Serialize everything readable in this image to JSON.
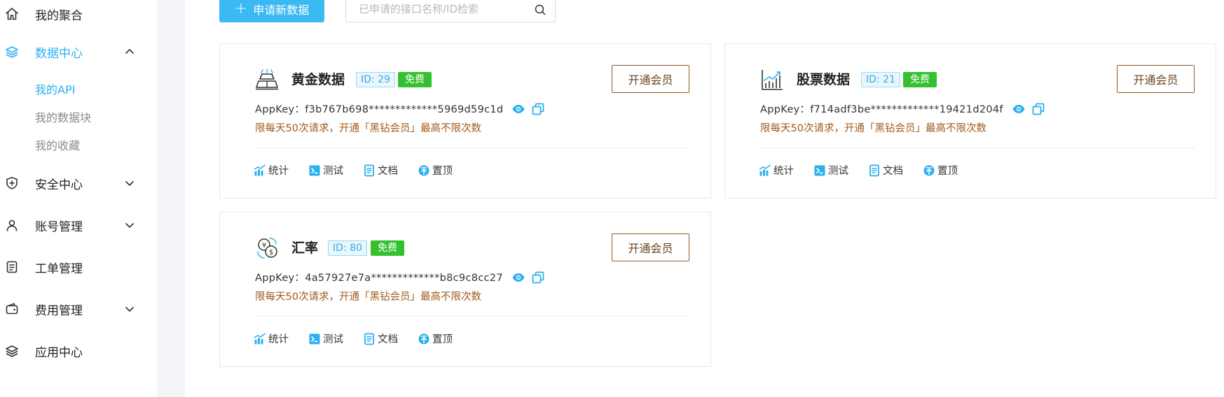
{
  "sidebar": {
    "items": [
      {
        "label": "我的聚合"
      },
      {
        "label": "数据中心"
      },
      {
        "label": "安全中心"
      },
      {
        "label": "账号管理"
      },
      {
        "label": "工单管理"
      },
      {
        "label": "费用管理"
      },
      {
        "label": "应用中心"
      }
    ],
    "sub_items": [
      {
        "label": "我的API"
      },
      {
        "label": "我的数据块"
      },
      {
        "label": "我的收藏"
      }
    ]
  },
  "toolbar": {
    "new_button_label": "申请新数据",
    "search_placeholder": "已申请的接口名称/ID检索",
    "search_value": ""
  },
  "cards": [
    {
      "title": "黄金数据",
      "id_badge": "ID: 29",
      "free_badge": "免费",
      "vip_button": "开通会员",
      "appkey": "AppKey：f3b767b698*************5969d59c1d",
      "limit": "限每天50次请求，开通「黑钻会员」最高不限次数",
      "icon": "gold-bars-icon"
    },
    {
      "title": "股票数据",
      "id_badge": "ID: 21",
      "free_badge": "免费",
      "vip_button": "开通会员",
      "appkey": "AppKey：f714adf3be*************19421d204f",
      "limit": "限每天50次请求，开通「黑钻会员」最高不限次数",
      "icon": "stock-chart-icon"
    },
    {
      "title": "汇率",
      "id_badge": "ID: 80",
      "free_badge": "免费",
      "vip_button": "开通会员",
      "appkey": "AppKey：4a57927e7a*************b8c9c8cc27",
      "limit": "限每天50次请求，开通「黑钻会员」最高不限次数",
      "icon": "currency-exchange-icon"
    }
  ],
  "actions": {
    "stats": "统计",
    "test": "测试",
    "docs": "文档",
    "pin": "置顶"
  },
  "colors": {
    "accent": "#2bb0ee",
    "primary_button": "#3bb9f3",
    "free_badge": "#35c12f",
    "limit_text": "#a15a1c",
    "vip_border": "#8b5a2b"
  }
}
